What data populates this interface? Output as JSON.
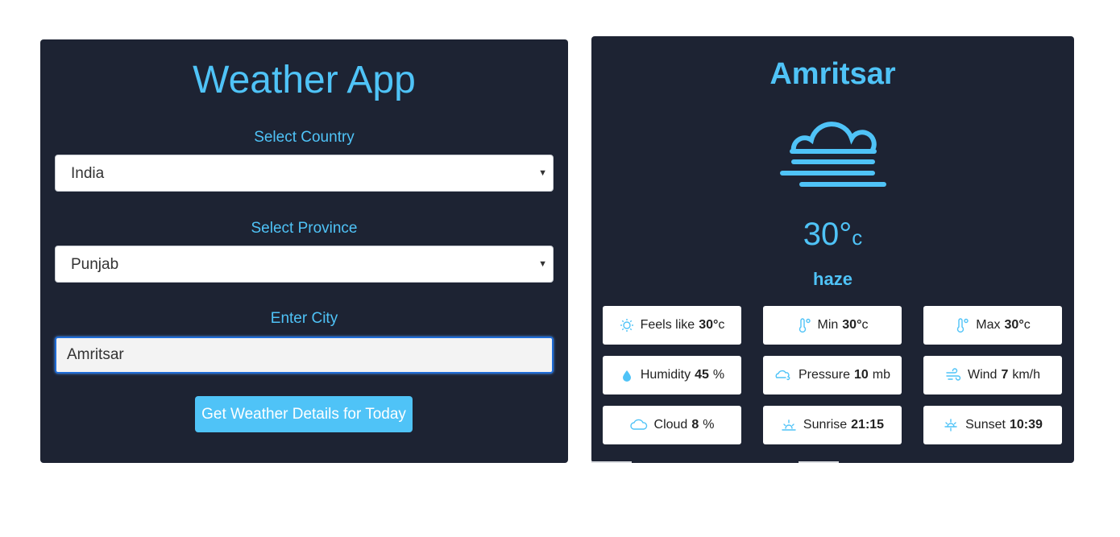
{
  "left": {
    "title": "Weather App",
    "country_label": "Select Country",
    "country_value": "India",
    "province_label": "Select Province",
    "province_value": "Punjab",
    "city_label": "Enter City",
    "city_value": "Amritsar",
    "button_label": "Get Weather Details for Today"
  },
  "right": {
    "city": "Amritsar",
    "icon": "haze-icon",
    "temp": "30°",
    "temp_unit": "c",
    "condition": "haze",
    "cards": [
      {
        "label": "Feels like",
        "value": "30°",
        "unit": "c",
        "icon": "sun-icon"
      },
      {
        "label": "Min",
        "value": "30°",
        "unit": "c",
        "icon": "thermometer-icon"
      },
      {
        "label": "Max",
        "value": "30°",
        "unit": "c",
        "icon": "thermometer-icon"
      },
      {
        "label": "Humidity",
        "value": "45",
        "unit": "%",
        "icon": "droplet-icon"
      },
      {
        "label": "Pressure",
        "value": "10",
        "unit": "mb",
        "icon": "cloud-wind-icon"
      },
      {
        "label": "Wind",
        "value": "7",
        "unit": "km/h",
        "icon": "wind-icon"
      },
      {
        "label": "Cloud",
        "value": "8",
        "unit": "%",
        "icon": "cloud-icon"
      },
      {
        "label": "Sunrise",
        "value": "21:15",
        "unit": "",
        "icon": "sunrise-icon"
      },
      {
        "label": "Sunset",
        "value": "10:39",
        "unit": "",
        "icon": "sunset-icon"
      }
    ]
  },
  "colors": {
    "panel": "#1d2333",
    "accent": "#4fc3f7",
    "focus_border": "#1e6bd6"
  }
}
